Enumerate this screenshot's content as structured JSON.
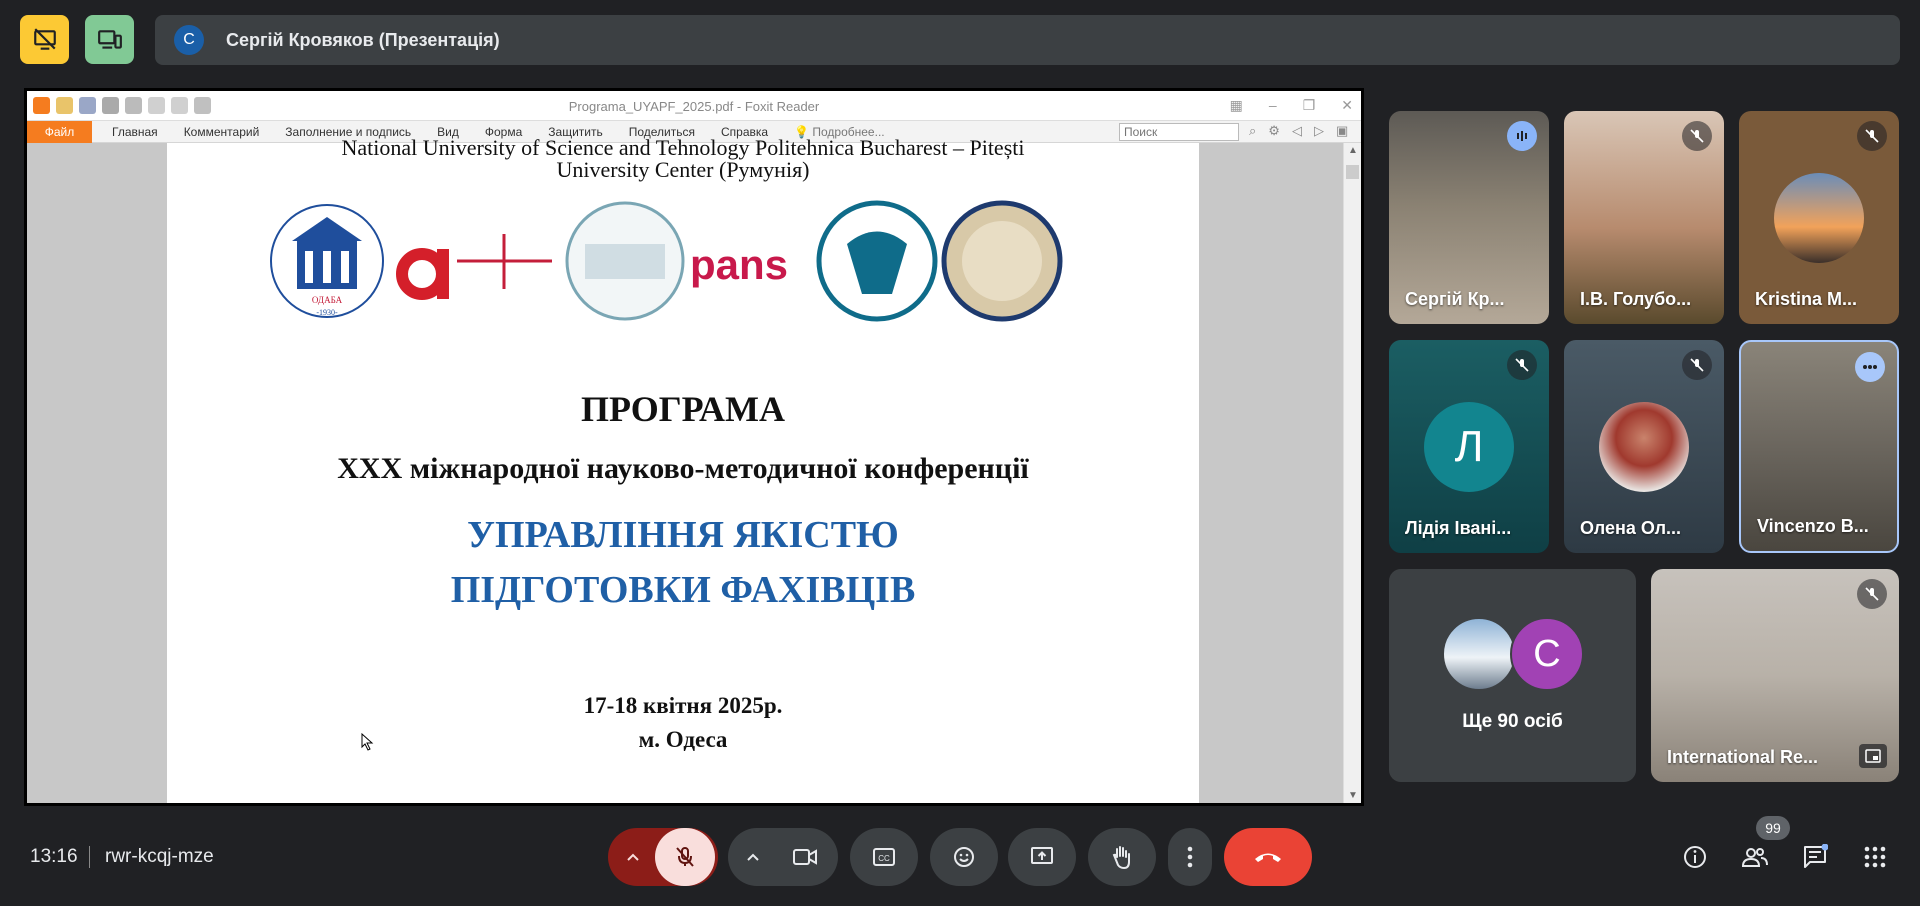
{
  "presenter": {
    "initial": "С",
    "name": "Сергій Кровяков (Презентація)"
  },
  "foxit": {
    "title": "Programa_UYAPF_2025.pdf - Foxit Reader",
    "menu": [
      "Файл",
      "Главная",
      "Комментарий",
      "Заполнение и подпись",
      "Вид",
      "Форма",
      "Защитить",
      "Поделиться",
      "Справка"
    ],
    "more": "Подробнее...",
    "search_placeholder": "Поиск"
  },
  "pdf": {
    "line1": "National University of Science and Tehnology Politehnica Bucharest – Pitești",
    "line2": "University Center (Румунія)",
    "logo_label_odaba": "ОДАБА",
    "logo_year": "-1930-",
    "logo_pans": "pans",
    "title": "ПРОГРАМА",
    "subtitle": "XXX міжнародної науково-методичної конференції",
    "blue1": "УПРАВЛІННЯ ЯКІСТЮ",
    "blue2": "ПІДГОТОВКИ ФАХІВЦІВ",
    "date": "17-18 квітня 2025р.",
    "city": "м. Одеса"
  },
  "participants": [
    {
      "name": "Сергій Кр..."
    },
    {
      "name": "І.В. Голубо..."
    },
    {
      "name": "Kristina M..."
    },
    {
      "name": "Лідія Івані...",
      "initial": "Л"
    },
    {
      "name": "Олена Ол..."
    },
    {
      "name": "Vincenzo B..."
    },
    {
      "name": "International Re..."
    }
  ],
  "others": {
    "label": "Ще 90 осіб",
    "initial": "C"
  },
  "bottom": {
    "time": "13:16",
    "meeting_code": "rwr-kcqj-mze",
    "people_count": "99"
  },
  "colors": {
    "end_call": "#ea4335",
    "mic_off_bg": "#f9dedc",
    "mic_arrow_bg": "#8c1d18",
    "presenter_avatar": "#1a5fa8",
    "lidia_avatar": "#12858f",
    "c_avatar": "#a142b4"
  }
}
